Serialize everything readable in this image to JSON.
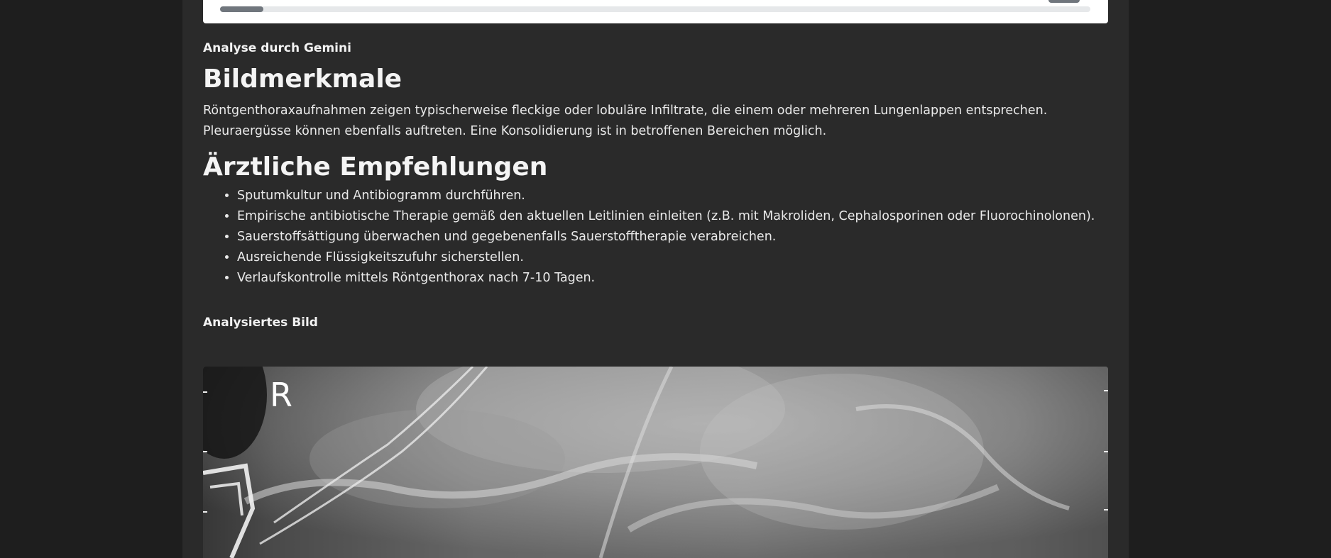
{
  "progress": {
    "value_fraction": 0.05
  },
  "analysis": {
    "label": "Analyse durch Gemini",
    "features_heading": "Bildmerkmale",
    "features_text": "Röntgenthoraxaufnahmen zeigen typischerweise fleckige oder lobuläre Infiltrate, die einem oder mehreren Lungenlappen entsprechen. Pleuraergüsse können ebenfalls auftreten. Eine Konsolidierung ist in betroffenen Bereichen möglich.",
    "recommendations_heading": "Ärztliche Empfehlungen",
    "recommendations": [
      "Sputumkultur und Antibiogramm durchführen.",
      "Empirische antibiotische Therapie gemäß den aktuellen Leitlinien einleiten (z.B. mit Makroliden, Cephalosporinen oder Fluorochinolonen).",
      "Sauerstoffsättigung überwachen und gegebenenfalls Sauerstofftherapie verabreichen.",
      "Ausreichende Flüssigkeitszufuhr sicherstellen.",
      "Verlaufskontrolle mittels Röntgenthorax nach 7-10 Tagen."
    ]
  },
  "image_section": {
    "label": "Analysiertes Bild",
    "marker_text": "R"
  }
}
